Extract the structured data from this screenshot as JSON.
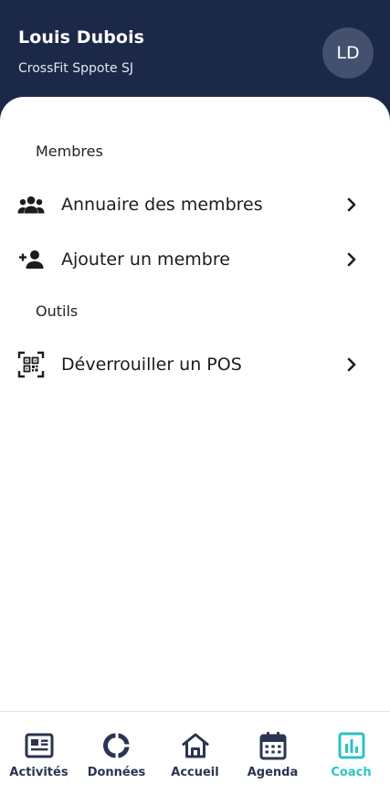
{
  "header": {
    "user_name": "Louis Dubois",
    "gym_name": "CrossFit Sppote SJ",
    "avatar_initials": "LD"
  },
  "sections": [
    {
      "title": "Membres",
      "items": [
        {
          "label": "Annuaire des membres",
          "icon": "group-icon"
        },
        {
          "label": "Ajouter un membre",
          "icon": "person-add-icon"
        }
      ]
    },
    {
      "title": "Outils",
      "items": [
        {
          "label": "Déverrouiller un POS",
          "icon": "qr-code-scan-icon"
        }
      ]
    }
  ],
  "nav": [
    {
      "label": "Activités",
      "icon": "newspaper-icon",
      "active": false
    },
    {
      "label": "Données",
      "icon": "donut-chart-icon",
      "active": false
    },
    {
      "label": "Accueil",
      "icon": "home-icon",
      "active": false
    },
    {
      "label": "Agenda",
      "icon": "calendar-icon",
      "active": false
    },
    {
      "label": "Coach",
      "icon": "bar-chart-icon",
      "active": true
    }
  ],
  "colors": {
    "header_bg": "#1c2848",
    "avatar_bg": "#43506e",
    "nav_text": "#2b3450",
    "accent": "#2bc3c3"
  }
}
